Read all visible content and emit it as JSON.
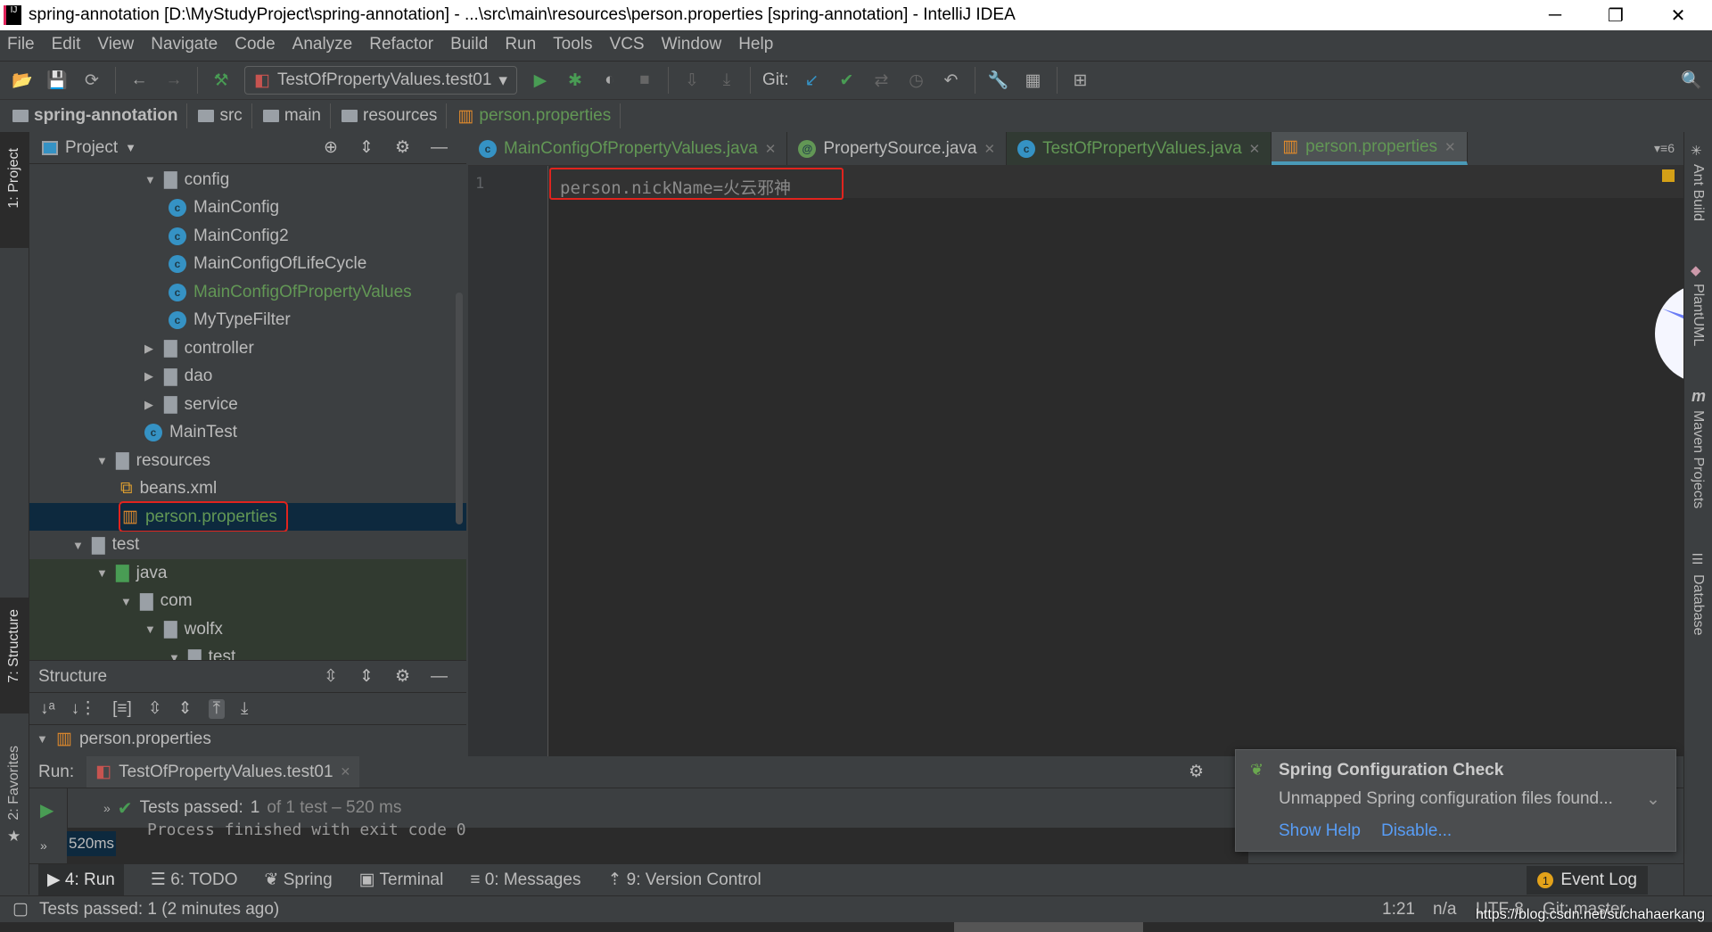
{
  "window": {
    "title": "spring-annotation [D:\\MyStudyProject\\spring-annotation] - ...\\src\\main\\resources\\person.properties [spring-annotation] - IntelliJ IDEA",
    "minimize": "─",
    "restore": "❐",
    "close": "✕"
  },
  "menu": [
    "File",
    "Edit",
    "View",
    "Navigate",
    "Code",
    "Analyze",
    "Refactor",
    "Build",
    "Run",
    "Tools",
    "VCS",
    "Window",
    "Help"
  ],
  "toolbar": {
    "run_config": "TestOfPropertyValues.test01",
    "git_label": "Git:"
  },
  "breadcrumb": [
    "spring-annotation",
    "src",
    "main",
    "resources",
    "person.properties"
  ],
  "project": {
    "title": "Project",
    "tree": [
      {
        "label": "config",
        "kind": "folder",
        "open": true,
        "level": 3
      },
      {
        "label": "MainConfig",
        "kind": "class",
        "level": 4
      },
      {
        "label": "MainConfig2",
        "kind": "class",
        "level": 4
      },
      {
        "label": "MainConfigOfLifeCycle",
        "kind": "class",
        "level": 4
      },
      {
        "label": "MainConfigOfPropertyValues",
        "kind": "class",
        "level": 4,
        "modified": true
      },
      {
        "label": "MyTypeFilter",
        "kind": "class",
        "level": 4
      },
      {
        "label": "controller",
        "kind": "folder",
        "open": false,
        "level": 3
      },
      {
        "label": "dao",
        "kind": "folder",
        "open": false,
        "level": 3
      },
      {
        "label": "service",
        "kind": "folder",
        "open": false,
        "level": 3
      },
      {
        "label": "MainTest",
        "kind": "testclass",
        "level": 3
      },
      {
        "label": "resources",
        "kind": "resfolder",
        "open": true,
        "level": 1
      },
      {
        "label": "beans.xml",
        "kind": "xml",
        "level": 2
      },
      {
        "label": "person.properties",
        "kind": "props",
        "level": 2,
        "selected": true
      },
      {
        "label": "test",
        "kind": "folder",
        "open": true,
        "level": 0
      },
      {
        "label": "java",
        "kind": "srcfolder",
        "open": true,
        "level": 1
      },
      {
        "label": "com",
        "kind": "folder",
        "open": true,
        "level": 2
      },
      {
        "label": "wolfx",
        "kind": "folder",
        "open": true,
        "level": 3
      },
      {
        "label": "test",
        "kind": "folder",
        "open": true,
        "level": 4
      }
    ]
  },
  "structure": {
    "title": "Structure",
    "root": "person.properties"
  },
  "tabs": [
    {
      "label": "MainConfigOfPropertyValues.java",
      "color": "#629755"
    },
    {
      "label": "PropertySource.java",
      "color": "#bbbbbb"
    },
    {
      "label": "TestOfPropertyValues.java",
      "color": "#629755"
    },
    {
      "label": "person.properties",
      "color": "#629755",
      "active": true
    }
  ],
  "tab_count": "6",
  "editor": {
    "line_number": "1",
    "code": "person.nickName=火云邪神"
  },
  "left_stripe": {
    "project": "1: Project",
    "structure": "7: Structure",
    "favorites": "2: Favorites"
  },
  "right_stripe": [
    "Ant Build",
    "PlantUML",
    "Maven Projects",
    "Database"
  ],
  "run": {
    "label": "Run:",
    "tab": "TestOfPropertyValues.test01",
    "tests_passed": "Tests passed:",
    "count": "1",
    "of_total": "of 1 test – 520 ms",
    "duration": "520ms",
    "console": "Process finished with exit code 0"
  },
  "tool_tabs": [
    "4: Run",
    "6: TODO",
    "Spring",
    "Terminal",
    "0: Messages",
    "9: Version Control"
  ],
  "event_log": {
    "label": "Event Log",
    "count": "1"
  },
  "notification": {
    "title": "Spring Configuration Check",
    "message": "Unmapped Spring configuration files found...",
    "show_help": "Show Help",
    "disable": "Disable..."
  },
  "status": {
    "message": "Tests passed: 1 (2 minutes ago)",
    "position": "1:21",
    "na": "n/a",
    "encoding": "UTF-8",
    "git": "Git: master",
    "watermark": "https://blog.csdn.net/suchahaerkang"
  }
}
